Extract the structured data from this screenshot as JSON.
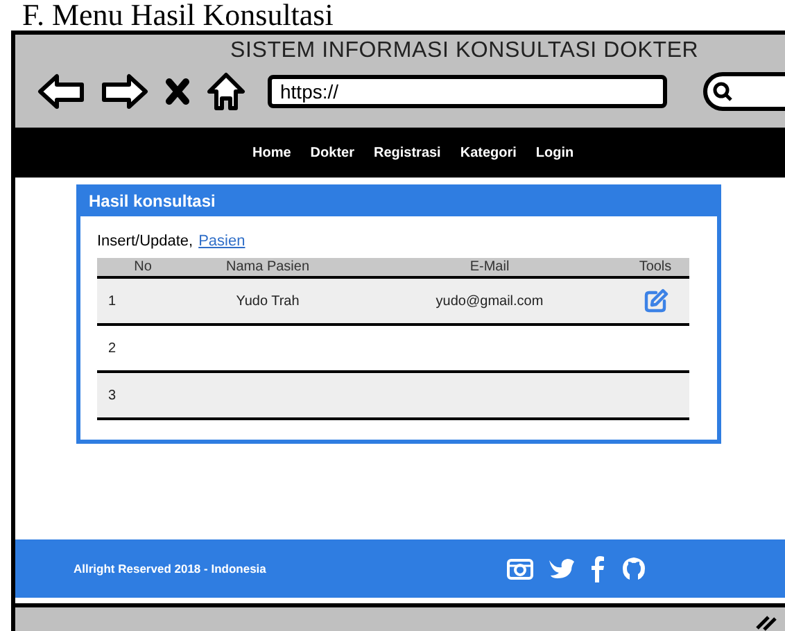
{
  "document": {
    "caption": "F. Menu Hasil Konsultasi"
  },
  "browser": {
    "title": "SISTEM INFORMASI KONSULTASI DOKTER",
    "address": "https://"
  },
  "nav": {
    "items": [
      "Home",
      "Dokter",
      "Registrasi",
      "Kategori",
      "Login"
    ]
  },
  "panel": {
    "title": "Hasil konsultasi",
    "intro": "Insert/Update,",
    "link": "Pasien",
    "table": {
      "columns": [
        "No",
        "Nama Pasien",
        "E-Mail",
        "Tools"
      ],
      "rows": [
        {
          "cells": [
            "1",
            "Yudo Trah",
            "yudo@gmail.com"
          ],
          "editable": true
        },
        {
          "cells": [
            "2"
          ],
          "editable": false
        },
        {
          "cells": [
            "3"
          ],
          "editable": false
        }
      ]
    }
  },
  "footer": {
    "text": "Allright Reserved 2018 - Indonesia"
  }
}
